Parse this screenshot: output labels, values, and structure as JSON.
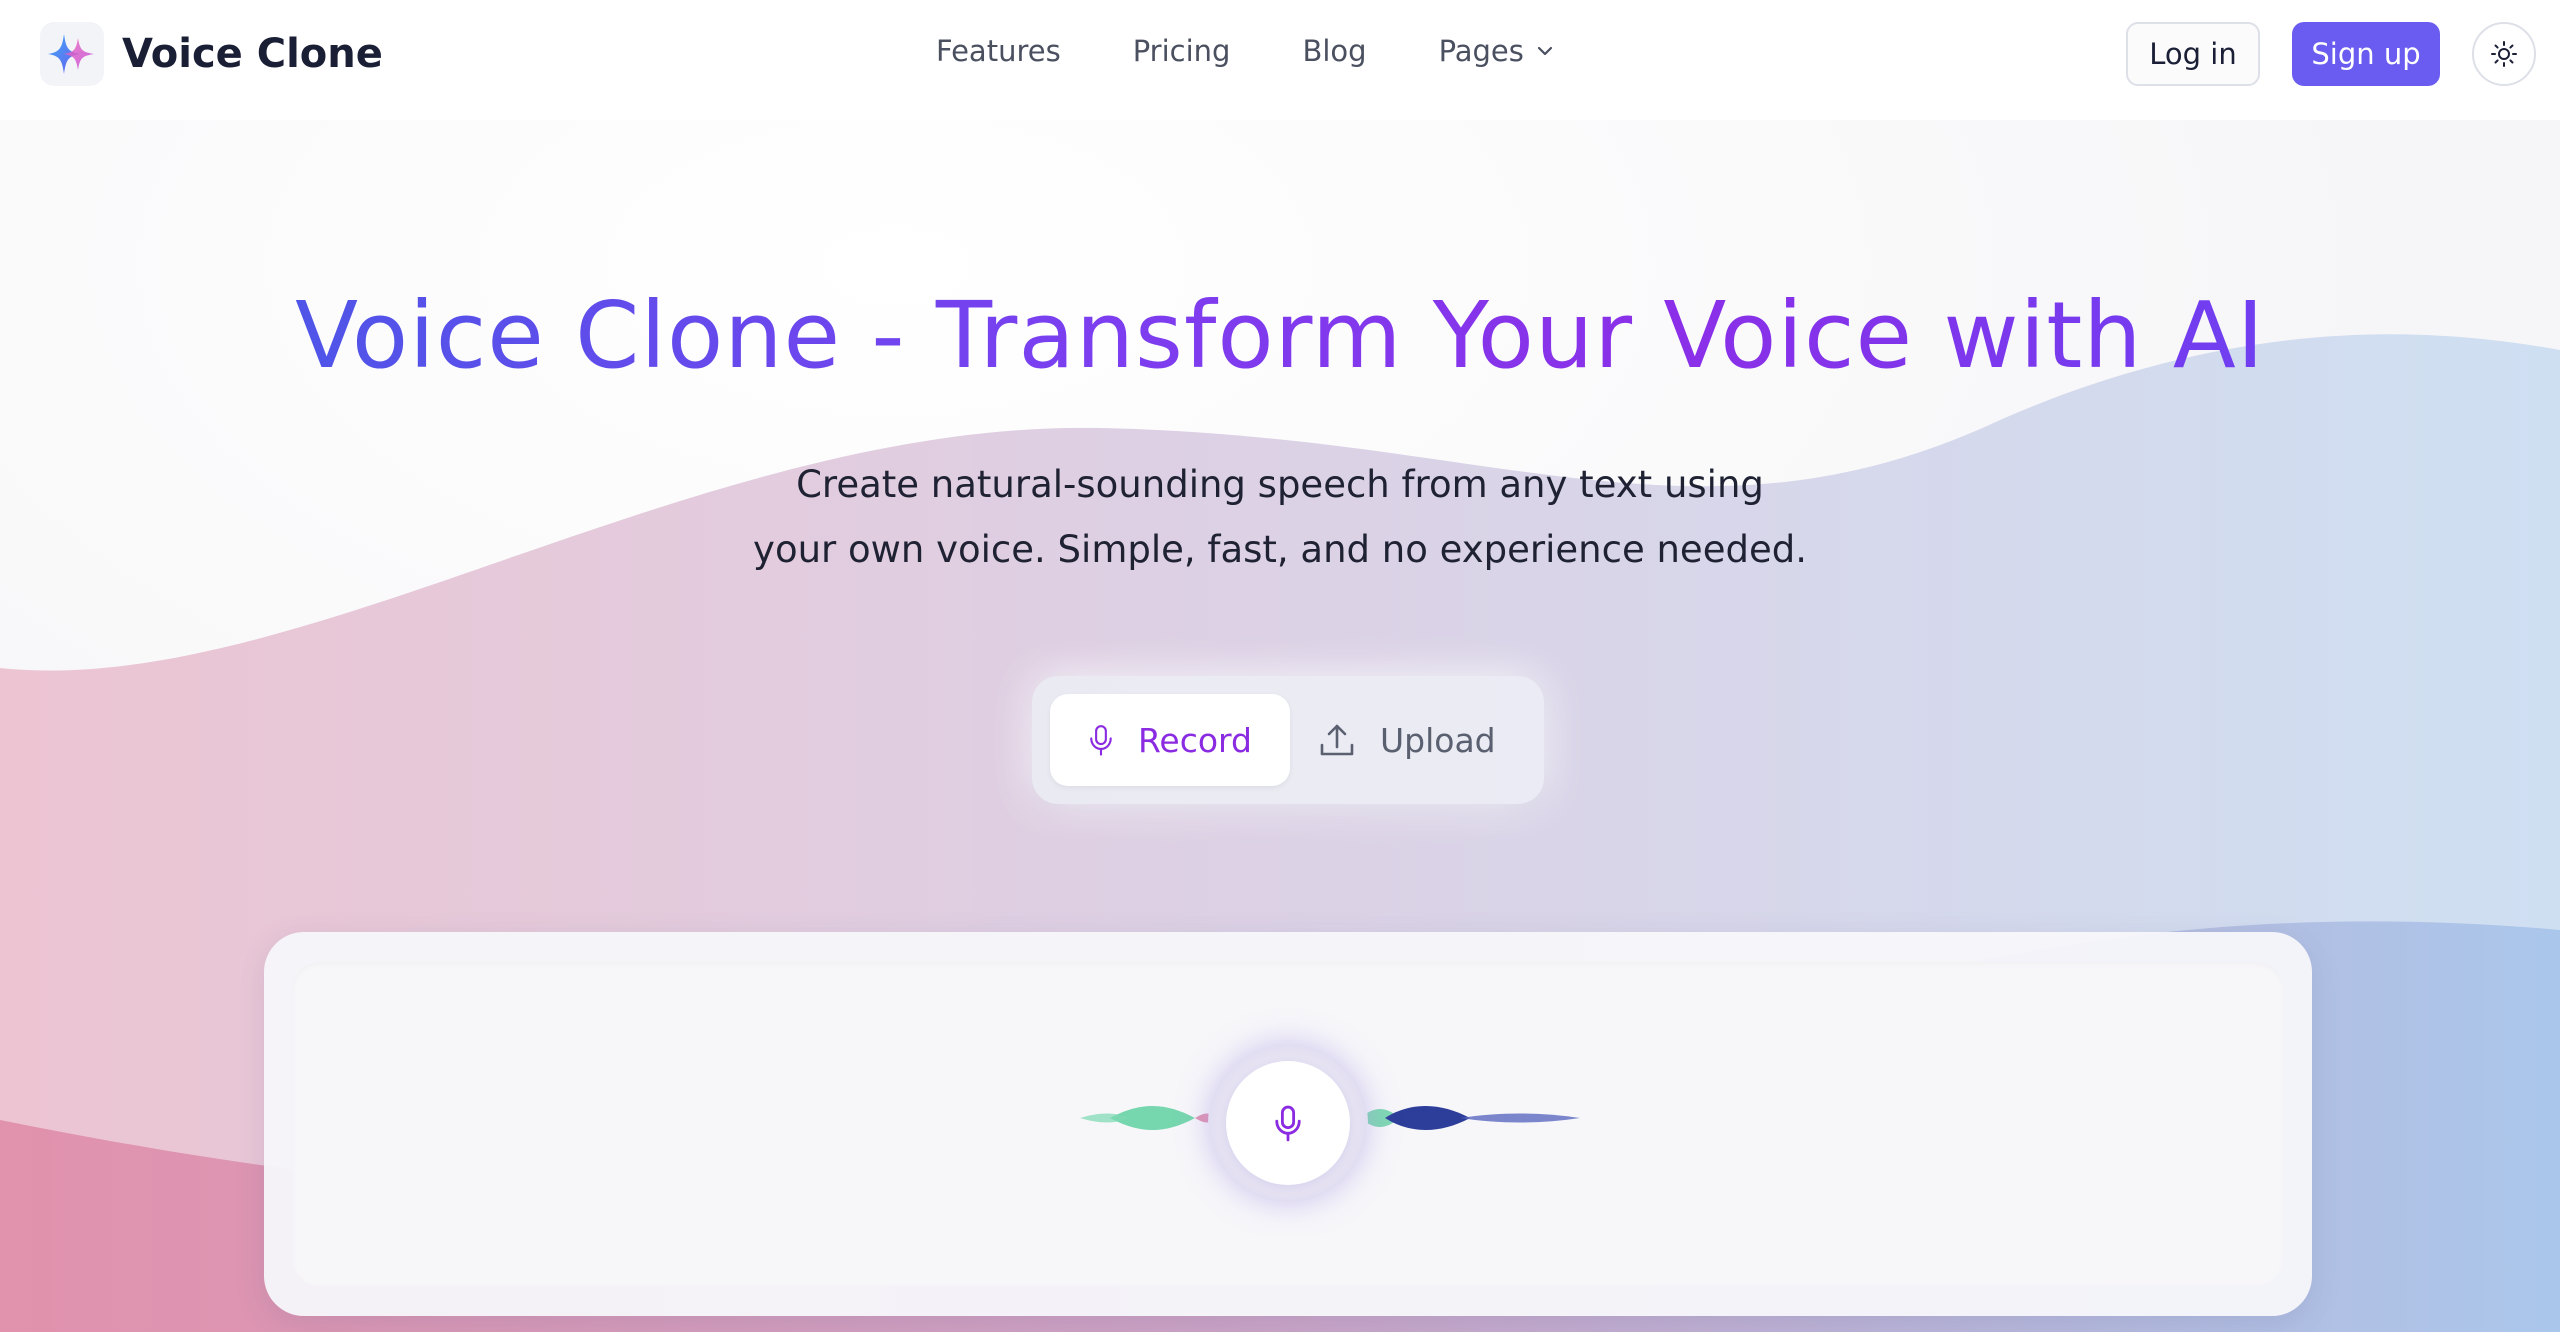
{
  "brand": {
    "name": "Voice Clone",
    "colors": {
      "accent": "#6a5cf0",
      "title_start": "#4f55e8",
      "title_end": "#8b2fe8",
      "record_active": "#8a2be2"
    }
  },
  "nav": {
    "items": [
      {
        "label": "Features"
      },
      {
        "label": "Pricing"
      },
      {
        "label": "Blog"
      },
      {
        "label": "Pages",
        "icon": "chevron-down-icon"
      }
    ]
  },
  "header": {
    "login_label": "Log in",
    "signup_label": "Sign up",
    "theme_icon": "sun-icon"
  },
  "hero": {
    "title": "Voice Clone - Transform Your Voice with AI",
    "subtitle_line1": "Create natural-sounding speech from any text using",
    "subtitle_line2": "your own voice. Simple, fast, and no experience needed."
  },
  "mode_toggle": {
    "options": [
      {
        "label": "Record",
        "icon": "microphone-icon",
        "active": true
      },
      {
        "label": "Upload",
        "icon": "upload-icon",
        "active": false
      }
    ]
  },
  "recorder": {
    "button_icon": "microphone-icon"
  }
}
